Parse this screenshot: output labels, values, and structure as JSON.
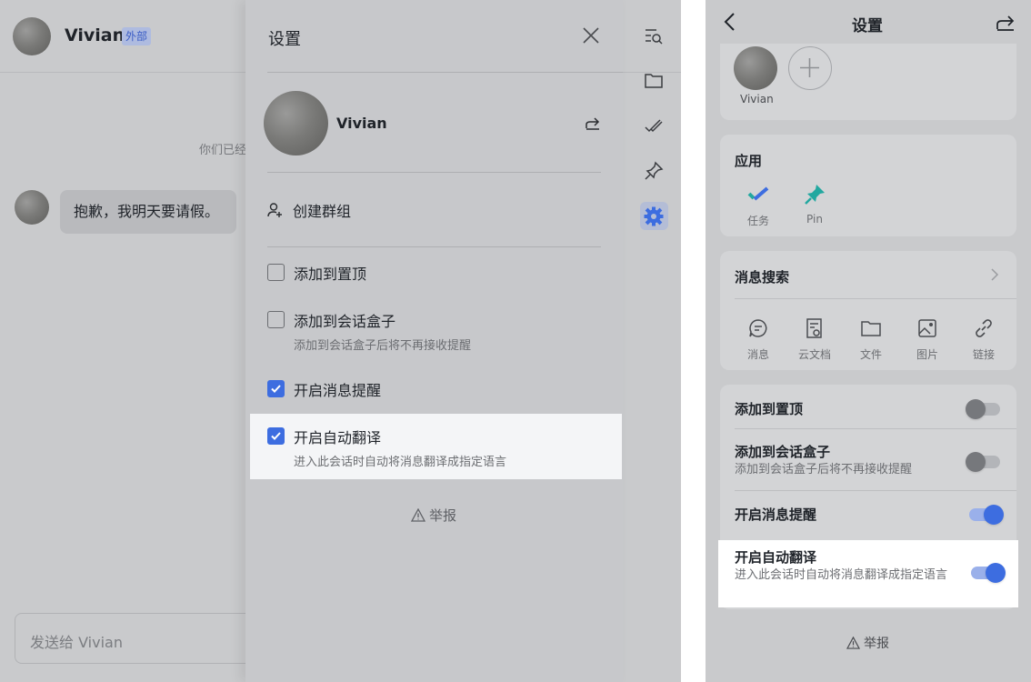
{
  "desktop": {
    "chat": {
      "name": "Vivian",
      "badge": "外部",
      "system_note": "你们已经",
      "message": "抱歉，我明天要请假。",
      "composer_placeholder": "发送给 Vivian"
    },
    "settings": {
      "title": "设置",
      "profile_name": "Vivian",
      "create_group": "创建群组",
      "options": [
        {
          "label": "添加到置顶",
          "sub": "",
          "checked": false
        },
        {
          "label": "添加到会话盒子",
          "sub": "添加到会话盒子后将不再接收提醒",
          "checked": false
        },
        {
          "label": "开启消息提醒",
          "sub": "",
          "checked": true
        },
        {
          "label": "开启自动翻译",
          "sub": "进入此会话时自动将消息翻译成指定语言",
          "checked": true
        }
      ],
      "report": "举报"
    },
    "rail_icons": [
      "search-list-icon",
      "folder-icon",
      "task-check-icon",
      "pin-icon",
      "gear-icon"
    ],
    "accent_color": "#3d6de0"
  },
  "mobile": {
    "title": "设置",
    "member_name": "Vivian",
    "apps": {
      "title": "应用",
      "items": [
        {
          "label": "任务",
          "icon": "task-icon"
        },
        {
          "label": "Pin",
          "icon": "pin-icon"
        }
      ]
    },
    "search": {
      "title": "消息搜索",
      "items": [
        {
          "label": "消息",
          "icon": "message-icon"
        },
        {
          "label": "云文档",
          "icon": "cloud-doc-icon"
        },
        {
          "label": "文件",
          "icon": "folder-icon"
        },
        {
          "label": "图片",
          "icon": "image-icon"
        },
        {
          "label": "链接",
          "icon": "link-icon"
        }
      ]
    },
    "toggles": [
      {
        "label": "添加到置顶",
        "sub": "",
        "on": false
      },
      {
        "label": "添加到会话盒子",
        "sub": "添加到会话盒子后将不再接收提醒",
        "on": false
      },
      {
        "label": "开启消息提醒",
        "sub": "",
        "on": true
      },
      {
        "label": "开启自动翻译",
        "sub": "进入此会话时自动将消息翻译成指定语言",
        "on": true
      }
    ],
    "report": "举报"
  }
}
